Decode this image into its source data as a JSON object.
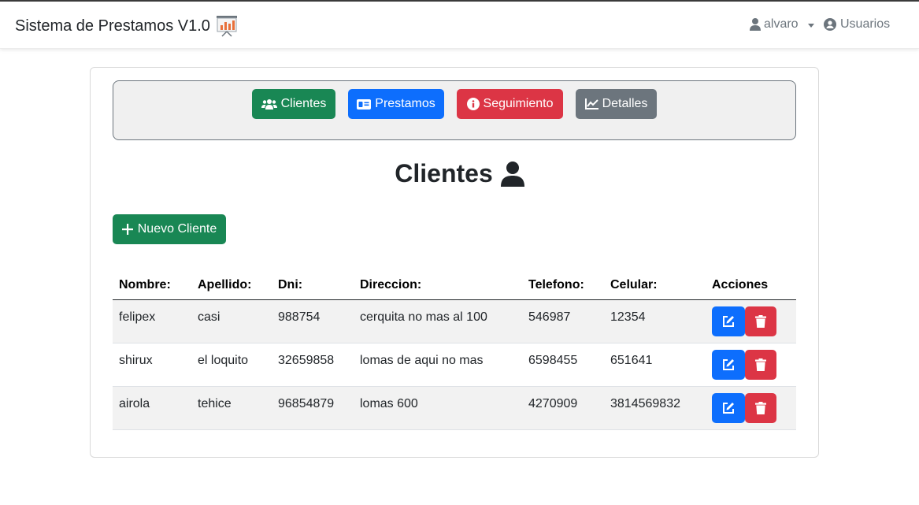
{
  "navbar": {
    "brand": "Sistema de Prestamos V1.0",
    "user": "alvaro",
    "users_link": "Usuarios"
  },
  "menu": {
    "clientes": "Clientes",
    "prestamos": "Prestamos",
    "seguimiento": "Seguimiento",
    "detalles": "Detalles"
  },
  "page": {
    "title": "Clientes",
    "new_button": "Nuevo Cliente"
  },
  "table": {
    "headers": [
      "Nombre:",
      "Apellido:",
      "Dni:",
      "Direccion:",
      "Telefono:",
      "Celular:",
      "Acciones"
    ],
    "rows": [
      [
        "felipex",
        "casi",
        "988754",
        "cerquita no mas al 100",
        "546987",
        "12354"
      ],
      [
        "shirux",
        "el loquito",
        "32659858",
        "lomas de aqui no mas",
        "6598455",
        "651641"
      ],
      [
        "airola",
        "tehice",
        "96854879",
        "lomas 600",
        "4270909",
        "3814569832"
      ]
    ]
  },
  "colors": {
    "success": "#198754",
    "primary": "#0d6efd",
    "danger": "#dc3545",
    "secondary": "#6c757d"
  },
  "icons": {
    "brand": "presentation-chart-icon",
    "user": "user-icon",
    "users": "user-circle-icon",
    "clientes": "users-icon",
    "prestamos": "id-card-icon",
    "seguimiento": "info-circle-icon",
    "detalles": "line-chart-icon",
    "title": "user-icon",
    "new": "plus-icon",
    "edit": "edit-icon",
    "delete": "trash-icon"
  }
}
